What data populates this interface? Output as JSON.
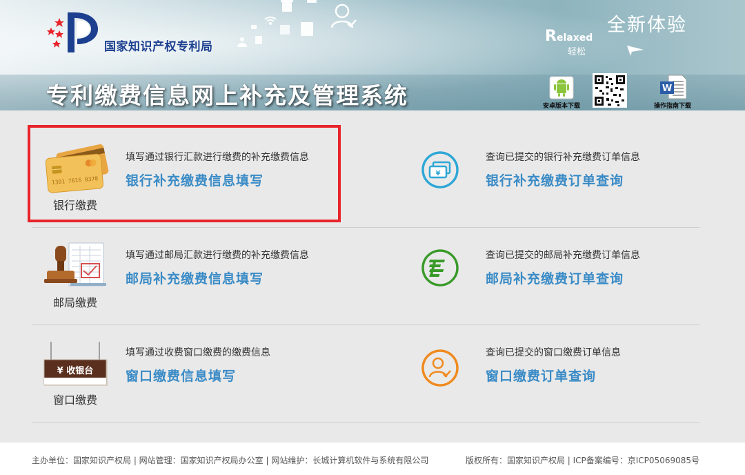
{
  "header": {
    "org_name": "国家知识产权专利局",
    "system_title": "专利缴费信息网上补充及管理系统",
    "new_experience": "全新体验",
    "relaxed_first": "R",
    "relaxed_rest": "elaxed",
    "relaxed_cn": "轻松",
    "android_download": "安卓版本下载",
    "guide_download": "操作指南下载",
    "logo_icon": "cnipa-logo-icon",
    "android_icon": "android-icon",
    "qr_icon": "qr-code-icon",
    "word_icon": "word-document-icon"
  },
  "services": [
    {
      "caption": "银行缴费",
      "fill_desc": "填写通过银行汇款进行缴费的补充缴费信息",
      "fill_link": "银行补充缴费信息填写",
      "query_desc": "查询已提交的银行补充缴费订单信息",
      "query_link": "银行补充缴费订单查询",
      "icon": "bank-card-icon",
      "query_icon": "bank-order-icon",
      "accent": "#2ea7d6"
    },
    {
      "caption": "邮局缴费",
      "fill_desc": "填写通过邮局汇款进行缴费的补充缴费信息",
      "fill_link": "邮局补充缴费信息填写",
      "query_desc": "查询已提交的邮局补充缴费订单信息",
      "query_link": "邮局补充缴费订单查询",
      "icon": "postal-stamp-icon",
      "query_icon": "postal-order-icon",
      "accent": "#3a9a2a"
    },
    {
      "caption": "窗口缴费",
      "fill_desc": "填写通过收费窗口缴费的缴费信息",
      "fill_link": "窗口缴费信息填写",
      "query_desc": "查询已提交的窗口缴费订单信息",
      "query_link": "窗口缴费订单查询",
      "icon": "cashier-sign-icon",
      "sign_text": "¥ 收银台",
      "query_icon": "window-order-icon",
      "accent": "#ef8a1f"
    }
  ],
  "colors": {
    "link": "#3a8bc6",
    "highlight": "#e8242a"
  },
  "footer": {
    "left": "主办单位：国家知识产权局 | 网站管理：国家知识产权局办公室 | 网站维护：长城计算机软件与系统有限公司",
    "right": "版权所有：国家知识产权局 | ICP备案编号：京ICP05069085号"
  }
}
